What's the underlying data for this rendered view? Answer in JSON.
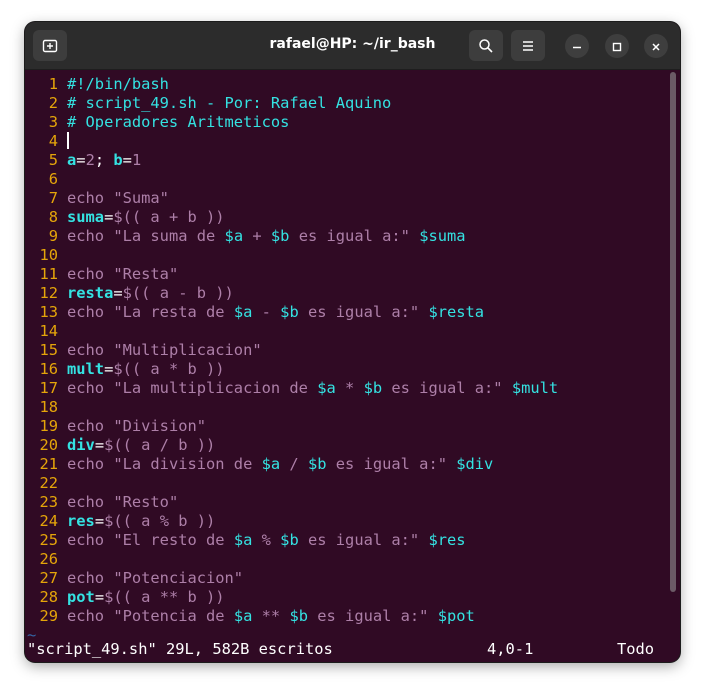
{
  "window": {
    "title": "rafael@HP: ~/ir_bash",
    "buttons": [
      "new-tab-icon",
      "search-icon",
      "menu-icon",
      "minimize-icon",
      "maximize-icon",
      "close-icon"
    ]
  },
  "colors": {
    "background": "#300a24",
    "line_number": "#e5a50a",
    "comment": "#34e2e2",
    "keyword": "#ad7fa8",
    "string": "#ad7fa8",
    "variable": "#34e2e2",
    "number": "#ad7fa8",
    "plain": "#ffffff"
  },
  "editor": {
    "lines": [
      {
        "n": "1",
        "tokens": [
          {
            "t": "#!/bin/bash",
            "c": "comment"
          }
        ]
      },
      {
        "n": "2",
        "tokens": [
          {
            "t": "# script_49.sh - Por: Rafael Aquino",
            "c": "comment"
          }
        ]
      },
      {
        "n": "3",
        "tokens": [
          {
            "t": "# Operadores Aritmeticos",
            "c": "comment"
          }
        ]
      },
      {
        "n": "4",
        "tokens": [],
        "cursor": true
      },
      {
        "n": "5",
        "tokens": [
          {
            "t": "a",
            "c": "varbold"
          },
          {
            "t": "=",
            "c": "plain"
          },
          {
            "t": "2",
            "c": "number"
          },
          {
            "t": "; ",
            "c": "plain"
          },
          {
            "t": "b",
            "c": "varbold"
          },
          {
            "t": "=",
            "c": "plain"
          },
          {
            "t": "1",
            "c": "number"
          }
        ]
      },
      {
        "n": "6",
        "tokens": []
      },
      {
        "n": "7",
        "tokens": [
          {
            "t": "echo ",
            "c": "keyword"
          },
          {
            "t": "\"Suma\"",
            "c": "string"
          }
        ]
      },
      {
        "n": "8",
        "tokens": [
          {
            "t": "suma",
            "c": "varbold"
          },
          {
            "t": "=",
            "c": "plain"
          },
          {
            "t": "$(( a + b ))",
            "c": "keyword"
          }
        ]
      },
      {
        "n": "9",
        "tokens": [
          {
            "t": "echo ",
            "c": "keyword"
          },
          {
            "t": "\"La suma de ",
            "c": "string"
          },
          {
            "t": "$a",
            "c": "variable"
          },
          {
            "t": " + ",
            "c": "string"
          },
          {
            "t": "$b",
            "c": "variable"
          },
          {
            "t": " es igual a:\" ",
            "c": "string"
          },
          {
            "t": "$suma",
            "c": "variable"
          }
        ]
      },
      {
        "n": "10",
        "tokens": []
      },
      {
        "n": "11",
        "tokens": [
          {
            "t": "echo ",
            "c": "keyword"
          },
          {
            "t": "\"Resta\"",
            "c": "string"
          }
        ]
      },
      {
        "n": "12",
        "tokens": [
          {
            "t": "resta",
            "c": "varbold"
          },
          {
            "t": "=",
            "c": "plain"
          },
          {
            "t": "$(( a - b ))",
            "c": "keyword"
          }
        ]
      },
      {
        "n": "13",
        "tokens": [
          {
            "t": "echo ",
            "c": "keyword"
          },
          {
            "t": "\"La resta de ",
            "c": "string"
          },
          {
            "t": "$a",
            "c": "variable"
          },
          {
            "t": " - ",
            "c": "string"
          },
          {
            "t": "$b",
            "c": "variable"
          },
          {
            "t": " es igual a:\" ",
            "c": "string"
          },
          {
            "t": "$resta",
            "c": "variable"
          }
        ]
      },
      {
        "n": "14",
        "tokens": []
      },
      {
        "n": "15",
        "tokens": [
          {
            "t": "echo ",
            "c": "keyword"
          },
          {
            "t": "\"Multiplicacion\"",
            "c": "string"
          }
        ]
      },
      {
        "n": "16",
        "tokens": [
          {
            "t": "mult",
            "c": "varbold"
          },
          {
            "t": "=",
            "c": "plain"
          },
          {
            "t": "$(( a * b ))",
            "c": "keyword"
          }
        ]
      },
      {
        "n": "17",
        "tokens": [
          {
            "t": "echo ",
            "c": "keyword"
          },
          {
            "t": "\"La multiplicacion de ",
            "c": "string"
          },
          {
            "t": "$a",
            "c": "variable"
          },
          {
            "t": " * ",
            "c": "string"
          },
          {
            "t": "$b",
            "c": "variable"
          },
          {
            "t": " es igual a:\" ",
            "c": "string"
          },
          {
            "t": "$mult",
            "c": "variable"
          }
        ]
      },
      {
        "n": "18",
        "tokens": []
      },
      {
        "n": "19",
        "tokens": [
          {
            "t": "echo ",
            "c": "keyword"
          },
          {
            "t": "\"Division\"",
            "c": "string"
          }
        ]
      },
      {
        "n": "20",
        "tokens": [
          {
            "t": "div",
            "c": "varbold"
          },
          {
            "t": "=",
            "c": "plain"
          },
          {
            "t": "$(( a / b ))",
            "c": "keyword"
          }
        ]
      },
      {
        "n": "21",
        "tokens": [
          {
            "t": "echo ",
            "c": "keyword"
          },
          {
            "t": "\"La division de ",
            "c": "string"
          },
          {
            "t": "$a",
            "c": "variable"
          },
          {
            "t": " / ",
            "c": "string"
          },
          {
            "t": "$b",
            "c": "variable"
          },
          {
            "t": " es igual a:\" ",
            "c": "string"
          },
          {
            "t": "$div",
            "c": "variable"
          }
        ]
      },
      {
        "n": "22",
        "tokens": []
      },
      {
        "n": "23",
        "tokens": [
          {
            "t": "echo ",
            "c": "keyword"
          },
          {
            "t": "\"Resto\"",
            "c": "string"
          }
        ]
      },
      {
        "n": "24",
        "tokens": [
          {
            "t": "res",
            "c": "varbold"
          },
          {
            "t": "=",
            "c": "plain"
          },
          {
            "t": "$(( a % b ))",
            "c": "keyword"
          }
        ]
      },
      {
        "n": "25",
        "tokens": [
          {
            "t": "echo ",
            "c": "keyword"
          },
          {
            "t": "\"El resto de ",
            "c": "string"
          },
          {
            "t": "$a",
            "c": "variable"
          },
          {
            "t": " % ",
            "c": "string"
          },
          {
            "t": "$b",
            "c": "variable"
          },
          {
            "t": " es igual a:\" ",
            "c": "string"
          },
          {
            "t": "$res",
            "c": "variable"
          }
        ]
      },
      {
        "n": "26",
        "tokens": []
      },
      {
        "n": "27",
        "tokens": [
          {
            "t": "echo ",
            "c": "keyword"
          },
          {
            "t": "\"Potenciacion\"",
            "c": "string"
          }
        ]
      },
      {
        "n": "28",
        "tokens": [
          {
            "t": "pot",
            "c": "varbold"
          },
          {
            "t": "=",
            "c": "plain"
          },
          {
            "t": "$(( a ** b ))",
            "c": "keyword"
          }
        ]
      },
      {
        "n": "29",
        "tokens": [
          {
            "t": "echo ",
            "c": "keyword"
          },
          {
            "t": "\"Potencia de ",
            "c": "string"
          },
          {
            "t": "$a",
            "c": "variable"
          },
          {
            "t": " ** ",
            "c": "string"
          },
          {
            "t": "$b",
            "c": "variable"
          },
          {
            "t": " es igual a:\" ",
            "c": "string"
          },
          {
            "t": "$pot",
            "c": "variable"
          }
        ]
      }
    ],
    "empty_line_marker": "~"
  },
  "status": {
    "message": "\"script_49.sh\" 29L, 582B escritos",
    "position": "4,0-1",
    "scroll": "Todo"
  }
}
